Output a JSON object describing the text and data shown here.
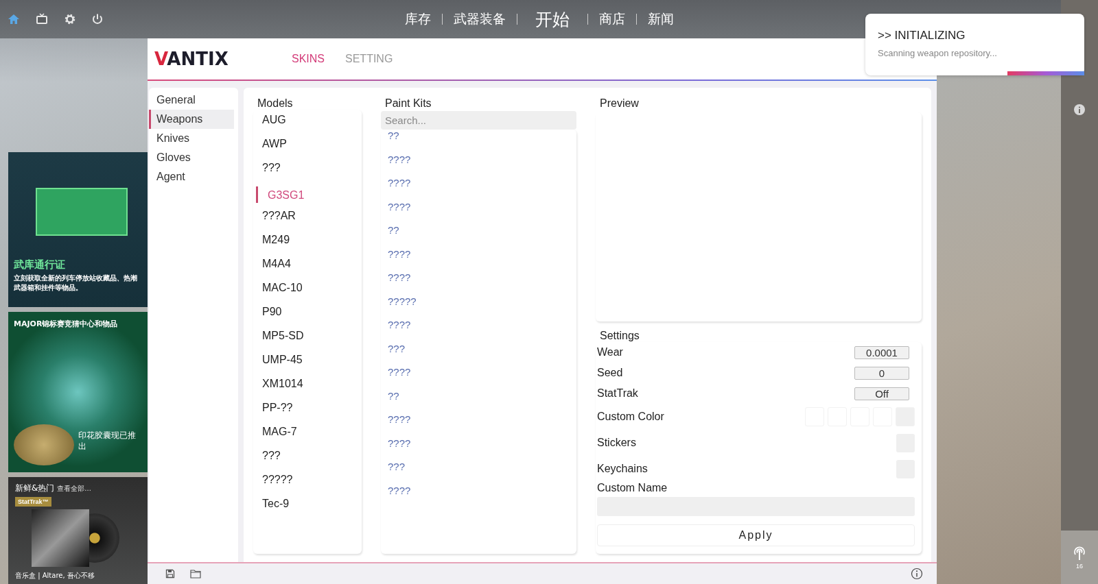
{
  "top_bar": {
    "icons": [
      {
        "kind": "home",
        "selected": true
      },
      {
        "kind": "tv",
        "selected": false
      },
      {
        "kind": "gear",
        "selected": false
      },
      {
        "kind": "power",
        "selected": false
      }
    ],
    "nav": [
      {
        "label": "库存",
        "kind": "link"
      },
      {
        "label": "武器装备",
        "kind": "link"
      },
      {
        "label": "开始",
        "kind": "play"
      },
      {
        "label": "商店",
        "kind": "link"
      },
      {
        "label": "新闻",
        "kind": "link"
      }
    ]
  },
  "store_cards": [
    {
      "kind": "pass",
      "title": "武库通行证",
      "text": "立刻获取全新的列车停放站收藏品、热潮武器箱和挂件等物品。"
    },
    {
      "kind": "major",
      "title": "MAJOR锦标赛竞猜中心和物品",
      "text": "印花胶囊现已推出"
    },
    {
      "kind": "music",
      "title": "新鲜&热门",
      "link": "查看全部...",
      "badge": "StatTrak™",
      "text": "音乐盒 | Altare, 吾心不移"
    }
  ],
  "app": {
    "logo": "VANTIX",
    "tabs": [
      {
        "label": "SKINS",
        "selected": true
      },
      {
        "label": "SETTING",
        "selected": false
      }
    ],
    "sidebar": [
      {
        "label": "General",
        "selected": false
      },
      {
        "label": "Weapons",
        "selected": true
      },
      {
        "label": "Knives",
        "selected": false
      },
      {
        "label": "Gloves",
        "selected": false
      },
      {
        "label": "Agent",
        "selected": false
      }
    ],
    "models": {
      "title": "Models",
      "items": [
        {
          "label": "AUG",
          "selected": false
        },
        {
          "label": "AWP",
          "selected": false
        },
        {
          "label": "???",
          "selected": false
        },
        {
          "label": "G3SG1",
          "selected": true
        },
        {
          "label": "???AR",
          "selected": false
        },
        {
          "label": "M249",
          "selected": false
        },
        {
          "label": "M4A4",
          "selected": false
        },
        {
          "label": "MAC-10",
          "selected": false
        },
        {
          "label": "P90",
          "selected": false
        },
        {
          "label": "MP5-SD",
          "selected": false
        },
        {
          "label": "UMP-45",
          "selected": false
        },
        {
          "label": "XM1014",
          "selected": false
        },
        {
          "label": "PP-??",
          "selected": false
        },
        {
          "label": "MAG-7",
          "selected": false
        },
        {
          "label": "???",
          "selected": false
        },
        {
          "label": "?????",
          "selected": false
        },
        {
          "label": "Tec-9",
          "selected": false
        }
      ]
    },
    "paint_kits": {
      "title": "Paint Kits",
      "search": {
        "placeholder": "Search..."
      },
      "items": [
        "??",
        "????",
        "????",
        "????",
        "??",
        "????",
        "????",
        "?????",
        "????",
        "???",
        "????",
        "??",
        "????",
        "????",
        "???",
        "????"
      ]
    },
    "preview": {
      "title": "Preview"
    },
    "settings": {
      "title": "Settings",
      "rows": [
        {
          "kind": "value",
          "label": "Wear",
          "value": "0.0001"
        },
        {
          "kind": "value",
          "label": "Seed",
          "value": "0"
        },
        {
          "kind": "value",
          "label": "StatTrak",
          "value": "Off"
        },
        {
          "kind": "swatches",
          "label": "Custom Color",
          "swatches": [
            {
              "color": "#ffffff"
            },
            {
              "color": "#ffffff"
            },
            {
              "color": "#ffffff"
            },
            {
              "color": "#ffffff"
            },
            {
              "color": "#efefef"
            }
          ]
        },
        {
          "kind": "picker",
          "label": "Stickers"
        },
        {
          "kind": "picker",
          "label": "Keychains"
        },
        {
          "kind": "text",
          "label": "Custom Name"
        }
      ],
      "apply": "Apply"
    }
  },
  "toast": {
    "title": ">> INITIALIZING",
    "text": "Scanning weapon repository..."
  },
  "right_strip": {
    "count": "16"
  }
}
